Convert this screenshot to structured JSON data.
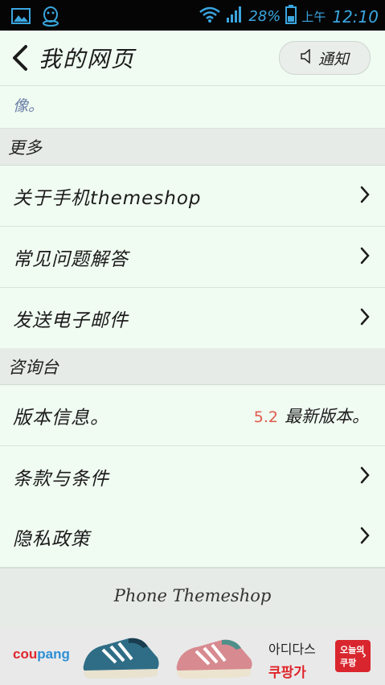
{
  "status_bar": {
    "battery": "28%",
    "ampm": "上午",
    "time": "12:10",
    "icons": [
      "image-icon",
      "qq-icon",
      "wifi-icon",
      "signal-icon",
      "battery-icon"
    ]
  },
  "header": {
    "title": "我的网页",
    "notice_label": "通知"
  },
  "partial_text": "像。",
  "sections": {
    "more": "更多",
    "console": "咨询台"
  },
  "more_items": [
    {
      "label": "关于手机themeshop"
    },
    {
      "label": "常见问题解答"
    },
    {
      "label": "发送电子邮件"
    }
  ],
  "console_items": [
    {
      "label": "版本信息。",
      "version": "5.2",
      "version_status": "最新版本。"
    },
    {
      "label": "条款与条件"
    },
    {
      "label": "隐私政策"
    }
  ],
  "footer": "Phone Themeshop",
  "ad": {
    "brand_coup": "cou",
    "brand_pang": "pang",
    "line1": "아디다스",
    "line2": "쿠팡가",
    "cta_1": "오늘의",
    "cta_2": "쿠팡",
    "colors": {
      "brand_red": "#e0262b",
      "brand_blue": "#2e8fd6",
      "cta": "#d9262e"
    }
  },
  "colors": {
    "background": "#f0fbf1",
    "section": "#e6ebe7",
    "status_icon": "#3aa6e0",
    "version": "#e05a4a"
  }
}
